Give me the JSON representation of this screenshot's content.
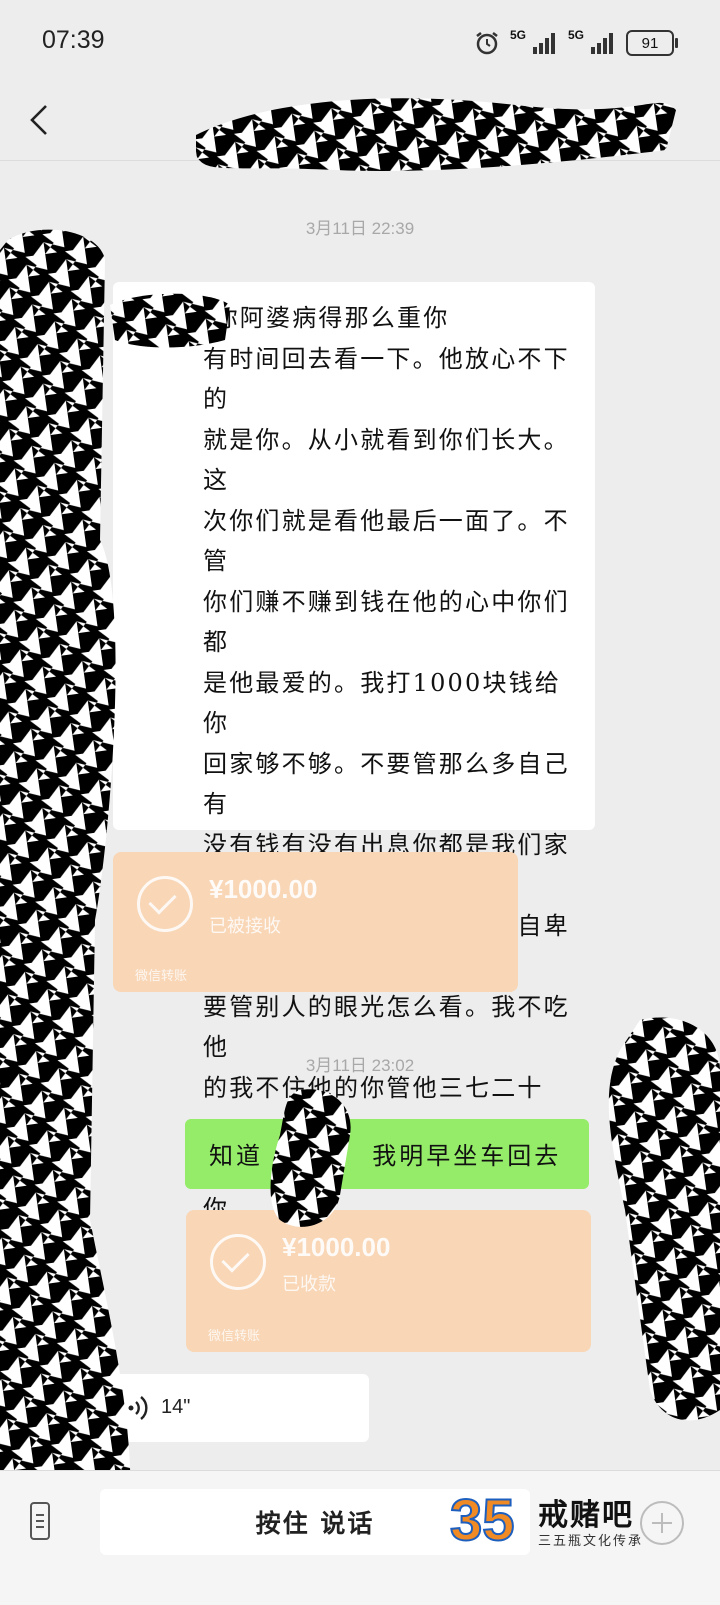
{
  "status_bar": {
    "time": "07:39",
    "network_1": "5G",
    "network_2": "5G",
    "battery": "91"
  },
  "nav": {
    "back_icon": "chevron-left-icon"
  },
  "messages": {
    "timestamp_1": "3月11日 22:39",
    "incoming_text": "觉未。你阿婆病得那么重你\n有时间回去看一下。他放心不下的\n就是你。从小就看到你们长大。这\n次你们就是看他最后一面了。不管\n你们赚不赚到钱在他的心中你们都\n是他最爱的。我打1000块钱给你\n回家够不够。不要管那么多自己有\n没有钱有没有出息你都是我们家里\n最好的不要想那么多，不要自卑不\n要管别人的眼光怎么看。我不吃他\n的我不住他的你管他三七二十一。\n我希望你回去看看你阿婆。相信你\n能做到的",
    "transfer_1": {
      "amount": "¥1000.00",
      "status": "已被接收",
      "footer": "微信转账"
    },
    "timestamp_2": "3月11日 23:02",
    "outgoing_text_1": "知道",
    "outgoing_text_2": "我明早坐车回去",
    "transfer_2": {
      "amount": "¥1000.00",
      "status": "已收款",
      "footer": "微信转账"
    },
    "voice_duration": "14\""
  },
  "input_bar": {
    "talk_label": "按住 说话"
  },
  "watermark": {
    "logo_text": "35",
    "name": "戒赌吧",
    "slogan": "三五瓶文化传承"
  },
  "colors": {
    "background": "#ededed",
    "incoming_bubble": "#ffffff",
    "outgoing_bubble": "#95ec69",
    "transfer_card": "#f8d6b6"
  }
}
